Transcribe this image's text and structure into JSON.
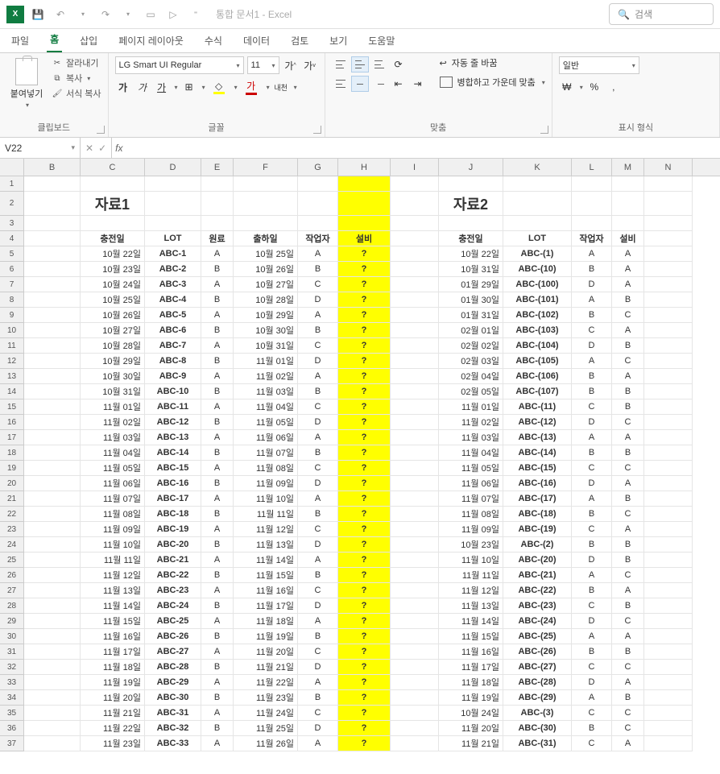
{
  "app": {
    "icon_text": "X",
    "doc_title": "통합 문서1 - Excel",
    "search_placeholder": "검색"
  },
  "qat": {
    "save": "save",
    "undo": "undo",
    "redo": "redo"
  },
  "tabs": {
    "file": "파일",
    "home": "홈",
    "insert": "삽입",
    "layout": "페이지 레이아웃",
    "formulas": "수식",
    "data": "데이터",
    "review": "검토",
    "view": "보기",
    "help": "도움말"
  },
  "ribbon": {
    "clipboard": {
      "paste": "붙여넣기",
      "cut": "잘라내기",
      "copy": "복사",
      "format_painter": "서식 복사",
      "label": "클립보드"
    },
    "font": {
      "name": "LG Smart UI Regular",
      "size": "11",
      "bold": "가",
      "italic": "가",
      "underline": "가",
      "ruby": "내천",
      "label": "글꼴"
    },
    "align": {
      "wrap": "자동 줄 바꿈",
      "merge": "병합하고 가운데 맞춤",
      "label": "맞춤"
    },
    "number": {
      "general": "일반",
      "label": "표시 형식"
    }
  },
  "namebox": "V22",
  "columns": [
    "B",
    "C",
    "D",
    "E",
    "F",
    "G",
    "H",
    "I",
    "J",
    "K",
    "L",
    "M",
    "N"
  ],
  "col_widths": [
    "wB",
    "wC",
    "wD",
    "wE",
    "wF",
    "wG",
    "wH",
    "wI",
    "wJ",
    "wK",
    "wL",
    "wM",
    "wN"
  ],
  "titles": {
    "t1": "자료1",
    "t2": "자료2"
  },
  "headers1": {
    "c": "충전일",
    "d": "LOT",
    "e": "원료",
    "f": "출하일",
    "g": "작업자",
    "h": "설비"
  },
  "headers2": {
    "j": "충전일",
    "k": "LOT",
    "l": "작업자",
    "m": "설비"
  },
  "data1": [
    {
      "c": "10월 22일",
      "d": "ABC-1",
      "e": "A",
      "f": "10월 25일",
      "g": "A",
      "h": "?"
    },
    {
      "c": "10월 23일",
      "d": "ABC-2",
      "e": "B",
      "f": "10월 26일",
      "g": "B",
      "h": "?"
    },
    {
      "c": "10월 24일",
      "d": "ABC-3",
      "e": "A",
      "f": "10월 27일",
      "g": "C",
      "h": "?"
    },
    {
      "c": "10월 25일",
      "d": "ABC-4",
      "e": "B",
      "f": "10월 28일",
      "g": "D",
      "h": "?"
    },
    {
      "c": "10월 26일",
      "d": "ABC-5",
      "e": "A",
      "f": "10월 29일",
      "g": "A",
      "h": "?"
    },
    {
      "c": "10월 27일",
      "d": "ABC-6",
      "e": "B",
      "f": "10월 30일",
      "g": "B",
      "h": "?"
    },
    {
      "c": "10월 28일",
      "d": "ABC-7",
      "e": "A",
      "f": "10월 31일",
      "g": "C",
      "h": "?"
    },
    {
      "c": "10월 29일",
      "d": "ABC-8",
      "e": "B",
      "f": "11월 01일",
      "g": "D",
      "h": "?"
    },
    {
      "c": "10월 30일",
      "d": "ABC-9",
      "e": "A",
      "f": "11월 02일",
      "g": "A",
      "h": "?"
    },
    {
      "c": "10월 31일",
      "d": "ABC-10",
      "e": "B",
      "f": "11월 03일",
      "g": "B",
      "h": "?"
    },
    {
      "c": "11월 01일",
      "d": "ABC-11",
      "e": "A",
      "f": "11월 04일",
      "g": "C",
      "h": "?"
    },
    {
      "c": "11월 02일",
      "d": "ABC-12",
      "e": "B",
      "f": "11월 05일",
      "g": "D",
      "h": "?"
    },
    {
      "c": "11월 03일",
      "d": "ABC-13",
      "e": "A",
      "f": "11월 06일",
      "g": "A",
      "h": "?"
    },
    {
      "c": "11월 04일",
      "d": "ABC-14",
      "e": "B",
      "f": "11월 07일",
      "g": "B",
      "h": "?"
    },
    {
      "c": "11월 05일",
      "d": "ABC-15",
      "e": "A",
      "f": "11월 08일",
      "g": "C",
      "h": "?"
    },
    {
      "c": "11월 06일",
      "d": "ABC-16",
      "e": "B",
      "f": "11월 09일",
      "g": "D",
      "h": "?"
    },
    {
      "c": "11월 07일",
      "d": "ABC-17",
      "e": "A",
      "f": "11월 10일",
      "g": "A",
      "h": "?"
    },
    {
      "c": "11월 08일",
      "d": "ABC-18",
      "e": "B",
      "f": "11월 11일",
      "g": "B",
      "h": "?"
    },
    {
      "c": "11월 09일",
      "d": "ABC-19",
      "e": "A",
      "f": "11월 12일",
      "g": "C",
      "h": "?"
    },
    {
      "c": "11월 10일",
      "d": "ABC-20",
      "e": "B",
      "f": "11월 13일",
      "g": "D",
      "h": "?"
    },
    {
      "c": "11월 11일",
      "d": "ABC-21",
      "e": "A",
      "f": "11월 14일",
      "g": "A",
      "h": "?"
    },
    {
      "c": "11월 12일",
      "d": "ABC-22",
      "e": "B",
      "f": "11월 15일",
      "g": "B",
      "h": "?"
    },
    {
      "c": "11월 13일",
      "d": "ABC-23",
      "e": "A",
      "f": "11월 16일",
      "g": "C",
      "h": "?"
    },
    {
      "c": "11월 14일",
      "d": "ABC-24",
      "e": "B",
      "f": "11월 17일",
      "g": "D",
      "h": "?"
    },
    {
      "c": "11월 15일",
      "d": "ABC-25",
      "e": "A",
      "f": "11월 18일",
      "g": "A",
      "h": "?"
    },
    {
      "c": "11월 16일",
      "d": "ABC-26",
      "e": "B",
      "f": "11월 19일",
      "g": "B",
      "h": "?"
    },
    {
      "c": "11월 17일",
      "d": "ABC-27",
      "e": "A",
      "f": "11월 20일",
      "g": "C",
      "h": "?"
    },
    {
      "c": "11월 18일",
      "d": "ABC-28",
      "e": "B",
      "f": "11월 21일",
      "g": "D",
      "h": "?"
    },
    {
      "c": "11월 19일",
      "d": "ABC-29",
      "e": "A",
      "f": "11월 22일",
      "g": "A",
      "h": "?"
    },
    {
      "c": "11월 20일",
      "d": "ABC-30",
      "e": "B",
      "f": "11월 23일",
      "g": "B",
      "h": "?"
    },
    {
      "c": "11월 21일",
      "d": "ABC-31",
      "e": "A",
      "f": "11월 24일",
      "g": "C",
      "h": "?"
    },
    {
      "c": "11월 22일",
      "d": "ABC-32",
      "e": "B",
      "f": "11월 25일",
      "g": "D",
      "h": "?"
    },
    {
      "c": "11월 23일",
      "d": "ABC-33",
      "e": "A",
      "f": "11월 26일",
      "g": "A",
      "h": "?"
    }
  ],
  "data2": [
    {
      "j": "10월 22일",
      "k": "ABC-(1)",
      "l": "A",
      "m": "A"
    },
    {
      "j": "10월 31일",
      "k": "ABC-(10)",
      "l": "B",
      "m": "A"
    },
    {
      "j": "01월 29일",
      "k": "ABC-(100)",
      "l": "D",
      "m": "A"
    },
    {
      "j": "01월 30일",
      "k": "ABC-(101)",
      "l": "A",
      "m": "B"
    },
    {
      "j": "01월 31일",
      "k": "ABC-(102)",
      "l": "B",
      "m": "C"
    },
    {
      "j": "02월 01일",
      "k": "ABC-(103)",
      "l": "C",
      "m": "A"
    },
    {
      "j": "02월 02일",
      "k": "ABC-(104)",
      "l": "D",
      "m": "B"
    },
    {
      "j": "02월 03일",
      "k": "ABC-(105)",
      "l": "A",
      "m": "C"
    },
    {
      "j": "02월 04일",
      "k": "ABC-(106)",
      "l": "B",
      "m": "A"
    },
    {
      "j": "02월 05일",
      "k": "ABC-(107)",
      "l": "B",
      "m": "B"
    },
    {
      "j": "11월 01일",
      "k": "ABC-(11)",
      "l": "C",
      "m": "B"
    },
    {
      "j": "11월 02일",
      "k": "ABC-(12)",
      "l": "D",
      "m": "C"
    },
    {
      "j": "11월 03일",
      "k": "ABC-(13)",
      "l": "A",
      "m": "A"
    },
    {
      "j": "11월 04일",
      "k": "ABC-(14)",
      "l": "B",
      "m": "B"
    },
    {
      "j": "11월 05일",
      "k": "ABC-(15)",
      "l": "C",
      "m": "C"
    },
    {
      "j": "11월 06일",
      "k": "ABC-(16)",
      "l": "D",
      "m": "A"
    },
    {
      "j": "11월 07일",
      "k": "ABC-(17)",
      "l": "A",
      "m": "B"
    },
    {
      "j": "11월 08일",
      "k": "ABC-(18)",
      "l": "B",
      "m": "C"
    },
    {
      "j": "11월 09일",
      "k": "ABC-(19)",
      "l": "C",
      "m": "A"
    },
    {
      "j": "10월 23일",
      "k": "ABC-(2)",
      "l": "B",
      "m": "B"
    },
    {
      "j": "11월 10일",
      "k": "ABC-(20)",
      "l": "D",
      "m": "B"
    },
    {
      "j": "11월 11일",
      "k": "ABC-(21)",
      "l": "A",
      "m": "C"
    },
    {
      "j": "11월 12일",
      "k": "ABC-(22)",
      "l": "B",
      "m": "A"
    },
    {
      "j": "11월 13일",
      "k": "ABC-(23)",
      "l": "C",
      "m": "B"
    },
    {
      "j": "11월 14일",
      "k": "ABC-(24)",
      "l": "D",
      "m": "C"
    },
    {
      "j": "11월 15일",
      "k": "ABC-(25)",
      "l": "A",
      "m": "A"
    },
    {
      "j": "11월 16일",
      "k": "ABC-(26)",
      "l": "B",
      "m": "B"
    },
    {
      "j": "11월 17일",
      "k": "ABC-(27)",
      "l": "C",
      "m": "C"
    },
    {
      "j": "11월 18일",
      "k": "ABC-(28)",
      "l": "D",
      "m": "A"
    },
    {
      "j": "11월 19일",
      "k": "ABC-(29)",
      "l": "A",
      "m": "B"
    },
    {
      "j": "10월 24일",
      "k": "ABC-(3)",
      "l": "C",
      "m": "C"
    },
    {
      "j": "11월 20일",
      "k": "ABC-(30)",
      "l": "B",
      "m": "C"
    },
    {
      "j": "11월 21일",
      "k": "ABC-(31)",
      "l": "C",
      "m": "A"
    }
  ]
}
